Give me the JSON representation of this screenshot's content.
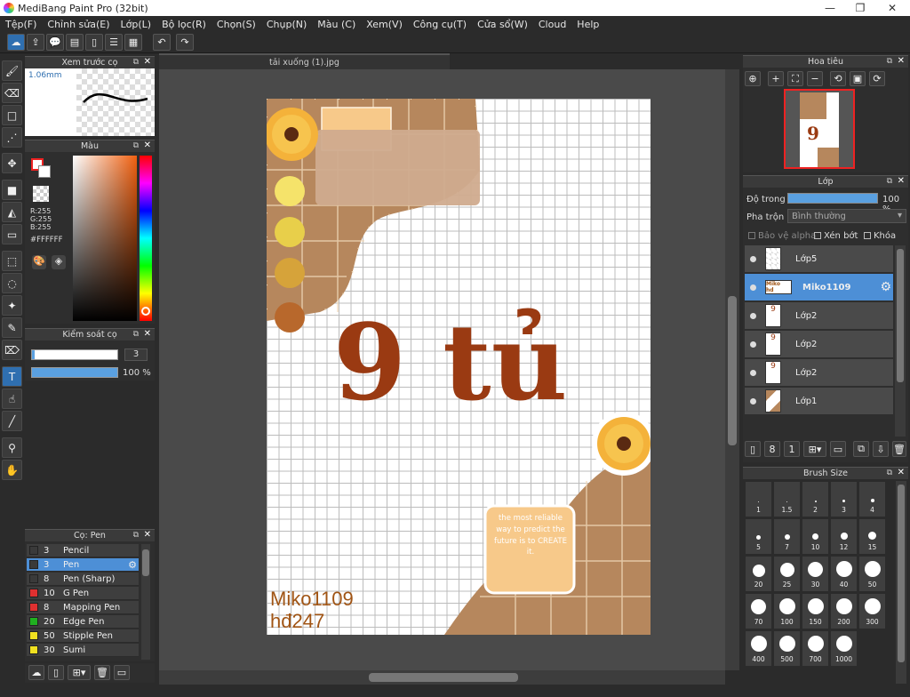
{
  "app": {
    "title": "MediBang Paint Pro (32bit)"
  },
  "menu": [
    "Tệp(F)",
    "Chỉnh sửa(E)",
    "Lớp(L)",
    "Bộ lọc(R)",
    "Chọn(S)",
    "Chụp(N)",
    "Màu (C)",
    "Xem(V)",
    "Công cụ(T)",
    "Cửa sổ(W)",
    "Cloud",
    "Help"
  ],
  "document": {
    "tab": "tải xuống (1).jpg"
  },
  "panels": {
    "preview": {
      "title": "Xem trước cọ",
      "size": "1.06mm"
    },
    "color": {
      "title": "Màu",
      "r": "R:255",
      "g": "G:255",
      "b": "B:255",
      "hex": "#FFFFFF"
    },
    "brush_control": {
      "title": "Kiểm soát cọ",
      "size": "3",
      "opacity": "100 %"
    },
    "brush_list": {
      "title": "Cọ: Pen",
      "items": [
        {
          "num": "3",
          "name": "Pencil",
          "color": "#3a3a3a"
        },
        {
          "num": "3",
          "name": "Pen",
          "color": "#3a3a3a"
        },
        {
          "num": "8",
          "name": "Pen (Sharp)",
          "color": "#3a3a3a"
        },
        {
          "num": "10",
          "name": "G Pen",
          "color": "#e03030"
        },
        {
          "num": "8",
          "name": "Mapping Pen",
          "color": "#e03030"
        },
        {
          "num": "20",
          "name": "Edge Pen",
          "color": "#20b020"
        },
        {
          "num": "50",
          "name": "Stipple Pen",
          "color": "#f0e020"
        },
        {
          "num": "30",
          "name": "Sumi",
          "color": "#f0e020"
        }
      ]
    },
    "navigator": {
      "title": "Hoa tiêu"
    },
    "layers": {
      "title": "Lớp",
      "opacity_label": "Độ trong",
      "opacity_value": "100 %",
      "blend_label": "Pha trộn",
      "blend_value": "Bình thường",
      "protect_alpha": "Bảo vệ alpha",
      "clipping": "Xén bớt",
      "lock": "Khóa",
      "items": [
        "Lớp5",
        "Miko1109",
        "Lớp2",
        "Lớp2",
        "Lớp2",
        "Lớp1"
      ]
    },
    "brush_size": {
      "title": "Brush Size",
      "sizes": [
        "1",
        "1.5",
        "2",
        "3",
        "4",
        "5",
        "7",
        "10",
        "12",
        "15",
        "20",
        "25",
        "30",
        "40",
        "50",
        "70",
        "100",
        "150",
        "200",
        "300",
        "400",
        "500",
        "700",
        "1000"
      ]
    }
  },
  "canvas": {
    "big_text": "9 tủ",
    "quote": "the most reliable way to predict the future is to CREATE it.",
    "signature_line1": "Miko1109",
    "signature_line2": "hđ247",
    "colors": {
      "brown": "#9a3a12",
      "tan": "#b08060",
      "yellow": "#f0c040"
    }
  }
}
